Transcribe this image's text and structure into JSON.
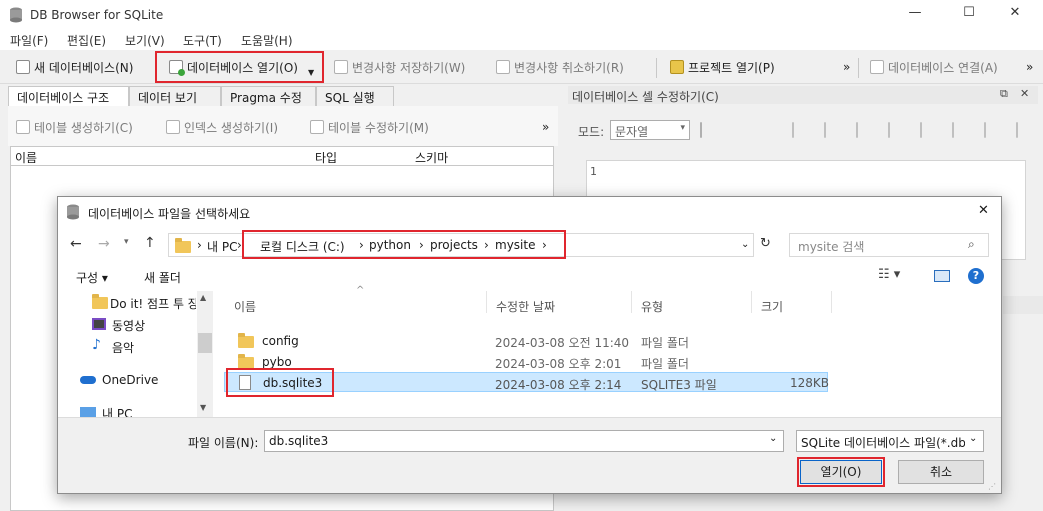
{
  "window": {
    "title": "DB Browser for SQLite",
    "controls": [
      "—",
      "☐",
      "✕"
    ]
  },
  "menu": [
    "파일(F)",
    "편집(E)",
    "보기(V)",
    "도구(T)",
    "도움말(H)"
  ],
  "toolbar": {
    "new_db": "새 데이터베이스(N)",
    "open_db": "데이터베이스 열기(O)",
    "write_changes": "변경사항 저장하기(W)",
    "revert_changes": "변경사항 취소하기(R)",
    "open_project": "프로젝트 열기(P)",
    "attach_db": "데이터베이스 연결(A)",
    "overflow": "»"
  },
  "left_tabs": [
    "데이터베이스 구조",
    "데이터 보기",
    "Pragma 수정",
    "SQL 실행"
  ],
  "left_tools": {
    "create_table": "테이블 생성하기(C)",
    "create_index": "인덱스 생성하기(I)",
    "modify_table": "테이블 수정하기(M)",
    "overflow": "»"
  },
  "tree_columns": [
    "이름",
    "타입",
    "스키마"
  ],
  "right_panel": {
    "title": "데이터베이스 셀 수정하기(C)",
    "mode_label": "모드:",
    "mode_value": "문자열",
    "line_number": "1"
  },
  "dialog": {
    "title": "데이터베이스 파일을 선택하세요",
    "path": {
      "root": "내 PC",
      "parts": [
        "로컬 디스크 (C:)",
        "python",
        "projects",
        "mysite"
      ]
    },
    "search_placeholder": "mysite 검색",
    "organize": "구성 ▾",
    "new_folder": "새 폴더",
    "nav_items": [
      "Do it! 점프 투 장",
      "동영상",
      "음악",
      "OneDrive",
      "내 PC"
    ],
    "columns": [
      "이름",
      "수정한 날짜",
      "유형",
      "크기"
    ],
    "files": [
      {
        "name": "config",
        "date": "2024-03-08 오전 11:40",
        "type": "파일 폴더",
        "size": ""
      },
      {
        "name": "pybo",
        "date": "2024-03-08 오후 2:01",
        "type": "파일 폴더",
        "size": ""
      },
      {
        "name": "db.sqlite3",
        "date": "2024-03-08 오후 2:14",
        "type": "SQLITE3 파일",
        "size": "128KB"
      }
    ],
    "filename_label": "파일 이름(N):",
    "filename_value": "db.sqlite3",
    "filter_value": "SQLite 데이터베이스 파일(*.db",
    "open_button": "열기(O)",
    "cancel_button": "취소"
  },
  "colors": {
    "highlight": "#e0262e",
    "selection": "#cce8ff",
    "accent": "#0a64c8"
  }
}
